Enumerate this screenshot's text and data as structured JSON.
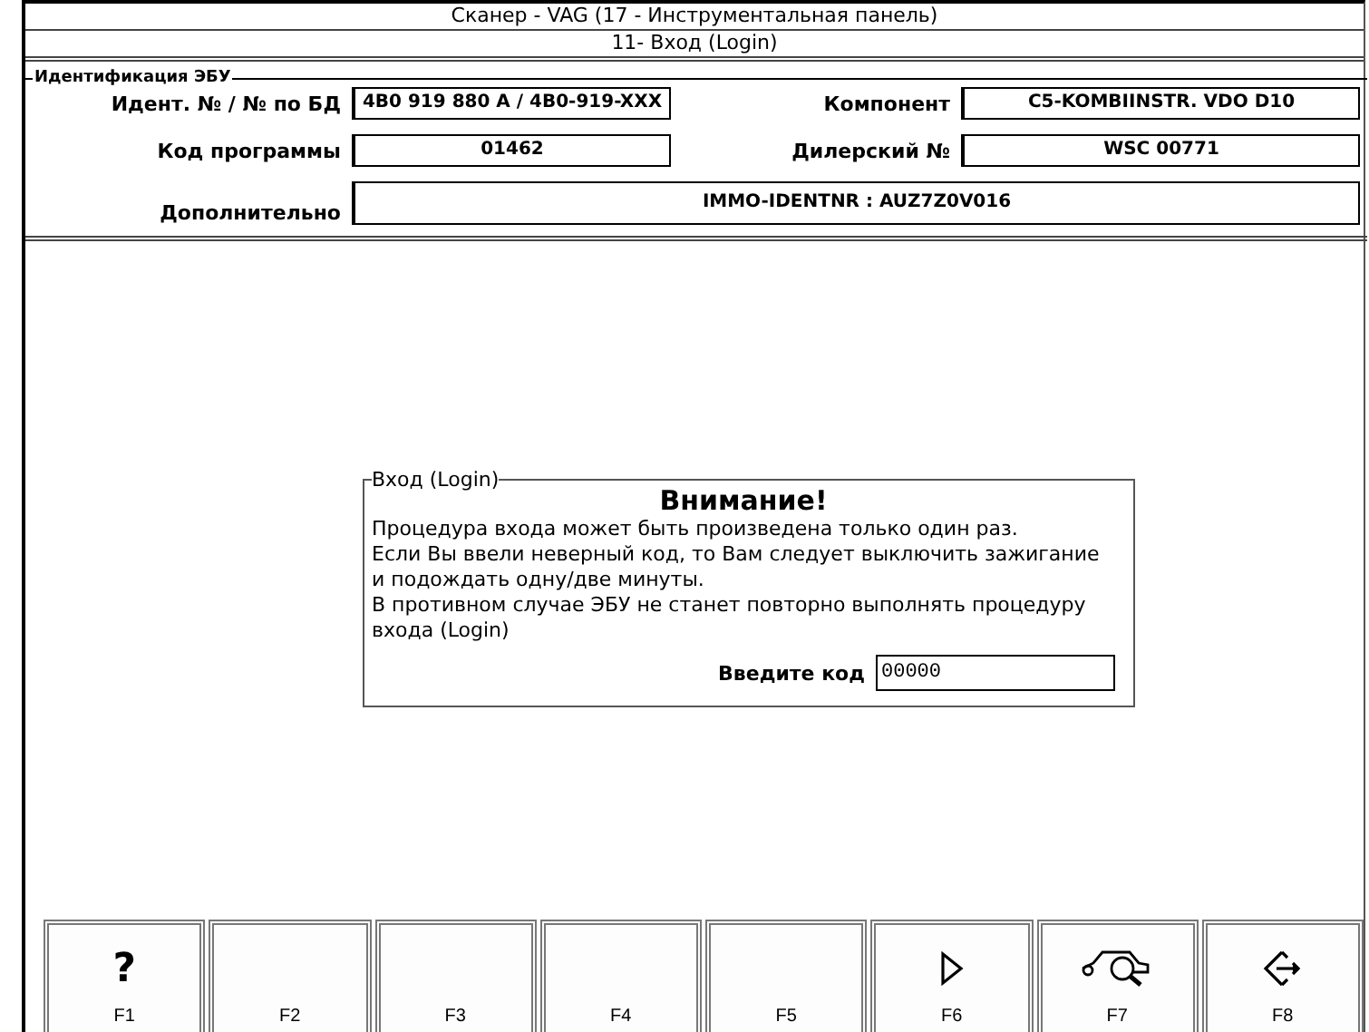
{
  "window": {
    "title": "Сканер - VAG (17 - Инструментальная панель)",
    "subtitle": "11- Вход (Login)"
  },
  "ecu_identification": {
    "legend": "Идентификация ЭБУ",
    "fields": [
      {
        "label": "Идент. № / № по БД",
        "value": "4B0 919 880 A / 4B0-919-XXX"
      },
      {
        "label": "Компонент",
        "value": "C5-KOMBIINSTR. VDO D10"
      },
      {
        "label": "Код программы",
        "value": "01462"
      },
      {
        "label": "Дилерский №",
        "value": "WSC 00771"
      }
    ],
    "extra": {
      "label": "Дополнительно",
      "value": "IMMO-IDENTNR : AUZ7Z0V016"
    }
  },
  "login_dialog": {
    "legend": "Вход (Login)",
    "heading": "Внимание!",
    "lines": [
      "Процедура входа может быть произведена только один раз.",
      "Если Вы ввели неверный код, то Вам следует выключить зажигание и подождать одну/две минуты.",
      "В противном случае ЭБУ не станет повторно выполнять процедуру входа (Login)"
    ],
    "code_label": "Введите код",
    "code_value": "00000"
  },
  "function_keys": [
    {
      "key": "F1",
      "kind": "text",
      "icon_text": "?"
    },
    {
      "key": "F2",
      "kind": "none"
    },
    {
      "key": "F3",
      "kind": "none"
    },
    {
      "key": "F4",
      "kind": "none"
    },
    {
      "key": "F5",
      "kind": "none"
    },
    {
      "key": "F6",
      "kind": "play"
    },
    {
      "key": "F7",
      "kind": "car-search"
    },
    {
      "key": "F8",
      "kind": "exit"
    }
  ]
}
